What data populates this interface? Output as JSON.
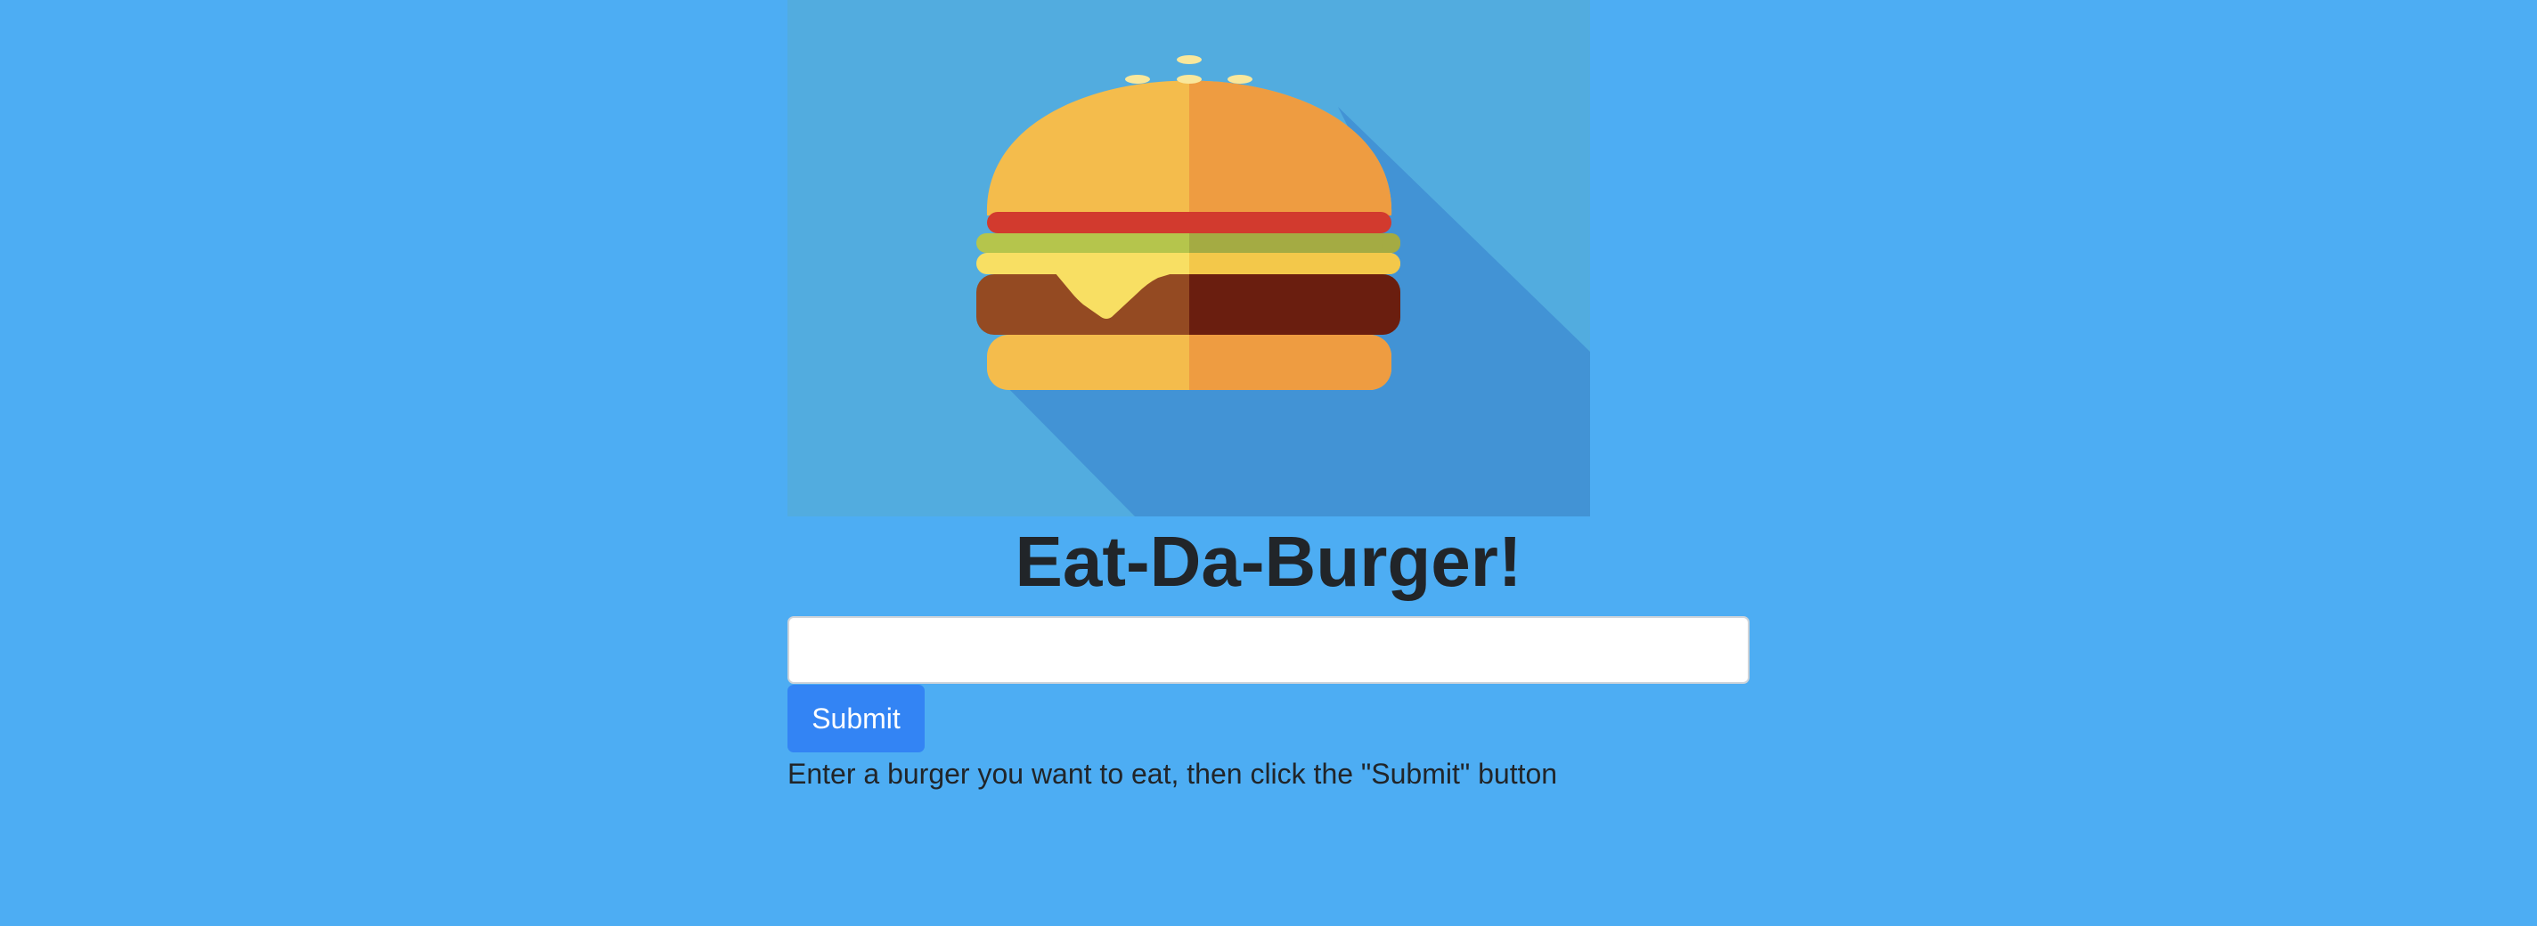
{
  "hero": {
    "image_name": "burger-illustration",
    "colors": {
      "background": "#52acdf",
      "shadow": "#4293d5",
      "bun_light": "#f4bc4c",
      "bun_dark": "#ee9c41",
      "sesame": "#f9e79b",
      "tomato": "#d23a2e",
      "lettuce": "#b5c54c",
      "cheese": "#f8df63",
      "patty_light": "#944a22",
      "patty_dark": "#6a1e0f"
    }
  },
  "page": {
    "title": "Eat-Da-Burger!",
    "background_color": "#4dadf3"
  },
  "form": {
    "input_value": "",
    "input_placeholder": "",
    "submit_label": "Submit",
    "submit_color": "#3384f4",
    "helper_text": "Enter a burger you want to eat, then click the \"Submit\" button"
  }
}
